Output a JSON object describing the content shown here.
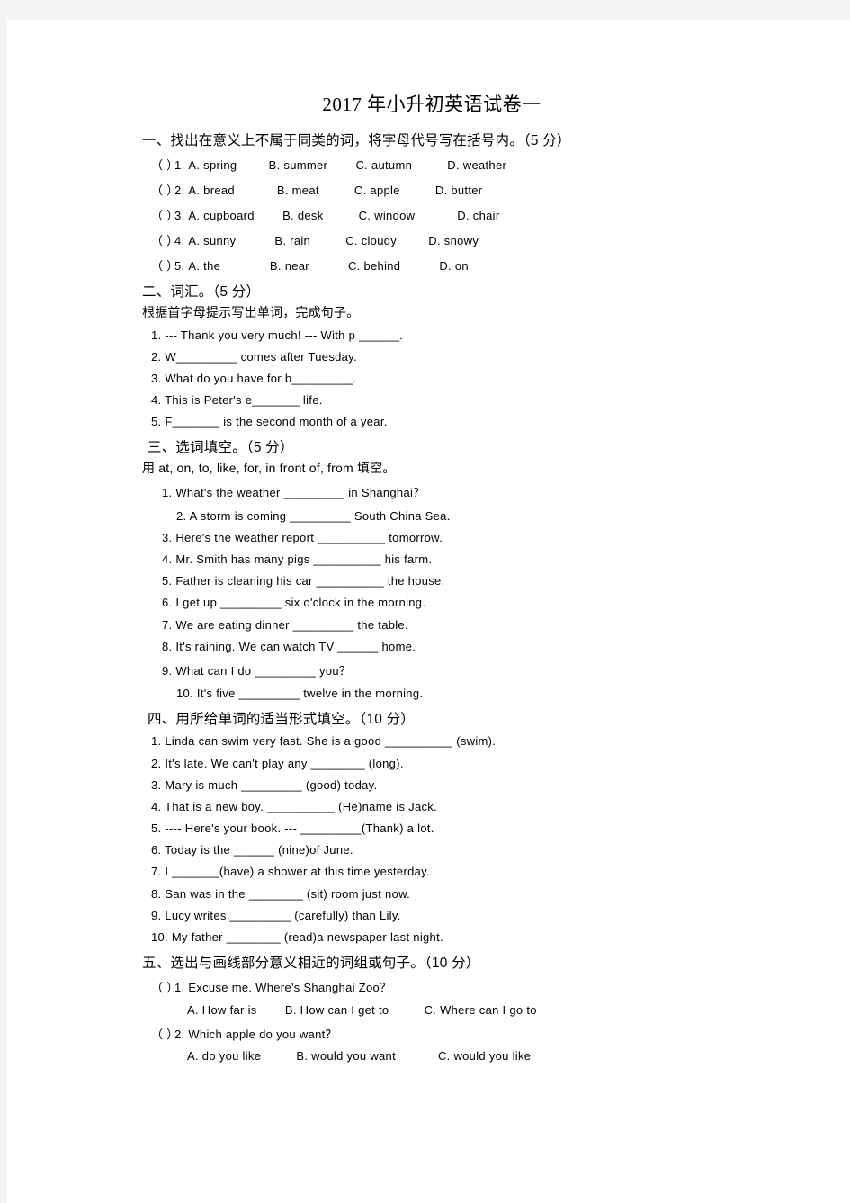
{
  "document": {
    "title": "2017 年小升初英语试卷一",
    "background_color": "#f4f4f4",
    "page_color": "#ffffff",
    "text_color": "#000000"
  },
  "sections": [
    {
      "heading": "一、找出在意义上不属于同类的词，将字母代号写在括号内。（5 分）",
      "items": [
        {
          "paren": "（  ）",
          "num": "1.",
          "a": "A. spring",
          "b": "B. summer",
          "c": "C. autumn",
          "d": "D. weather"
        },
        {
          "paren": "（  ）",
          "num": "2.",
          "a": "A. bread",
          "b": "B. meat",
          "c": "C. apple",
          "d": "D. butter"
        },
        {
          "paren": "（  ）",
          "num": "3.",
          "a": "A. cupboard",
          "b": "B. desk",
          "c": "C. window",
          "d": "D. chair"
        },
        {
          "paren": "（  ）",
          "num": "4.",
          "a": "A. sunny",
          "b": "B. rain",
          "c": "C. cloudy",
          "d": "D. snowy"
        },
        {
          "paren": "（  ）",
          "num": "5.",
          "a": "A. the",
          "b": "B. near",
          "c": "C. behind",
          "d": "D. on"
        }
      ]
    },
    {
      "heading": "二、词汇。（5 分）",
      "instruction": "根据首字母提示写出单词，完成句子。",
      "items": [
        "1. --- Thank you very much! --- With p ______.",
        "2. W_________ comes after Tuesday.",
        "3. What do you have for b_________.",
        "4. This is Peter's e_______ life.",
        "5. F_______ is the second month of a year."
      ]
    },
    {
      "heading": "三、选词填空。（5 分）",
      "instruction": "用 at, on, to, like, for, in front of, from 填空。",
      "items": [
        "1. What's the weather _________ in Shanghai？",
        "2. A storm is coming _________ South China Sea.",
        "3. Here's the weather report __________ tomorrow.",
        "4. Mr. Smith has many pigs __________ his farm.",
        "5. Father is cleaning his car __________ the house.",
        "6. I get up _________ six o'clock in the morning.",
        "7. We are eating dinner _________ the table.",
        "8. It's raining. We can watch TV ______ home.",
        "9. What can I do _________ you？",
        "10. It's five _________ twelve in the morning."
      ]
    },
    {
      "heading": "四、用所给单词的适当形式填空。（10 分）",
      "items": [
        "1. Linda can swim very fast. She is a good __________ (swim).",
        "2. It's late. We can't play any ________ (long).",
        "3. Mary is much _________ (good) today.",
        "4. That is a new boy. __________ (He)name is Jack.",
        "5. ---- Here's your book. --- _________(Thank) a lot.",
        "6. Today is the ______ (nine)of June.",
        "7. I _______(have) a shower at this time yesterday.",
        "8. San was in the ________ (sit) room just now.",
        "9. Lucy writes _________ (carefully) than Lily.",
        "10. My father ________ (read)a newspaper last night."
      ]
    },
    {
      "heading": "五、选出与画线部分意义相近的词组或句子。（10 分）",
      "mc_items": [
        {
          "paren": "（  ）",
          "stem": "1. Excuse me. Where's Shanghai Zoo？",
          "a": "A. How far is",
          "b": "B. How can I get to",
          "c": "C. Where can I go to"
        },
        {
          "paren": "（  ）",
          "stem": "2. Which apple do you want？",
          "a": "A. do you like",
          "b": "B. would you want",
          "c": "C. would you like"
        }
      ]
    }
  ]
}
